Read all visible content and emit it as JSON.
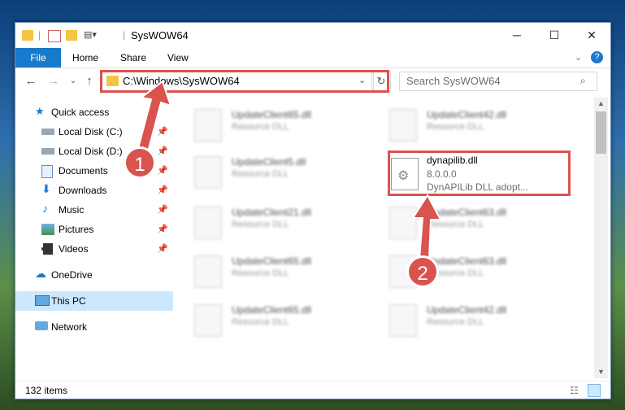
{
  "window": {
    "title": "SysWOW64",
    "controls": {
      "minimize": "─",
      "maximize": "☐",
      "close": "✕"
    }
  },
  "ribbon": {
    "file": "File",
    "tabs": [
      "Home",
      "Share",
      "View"
    ]
  },
  "address": {
    "path": "C:\\Windows\\SysWOW64",
    "search_placeholder": "Search SysWOW64"
  },
  "nav": {
    "quick_access": "Quick access",
    "items": [
      {
        "label": "Local Disk (C:)"
      },
      {
        "label": "Local Disk (D:)"
      },
      {
        "label": "Documents"
      },
      {
        "label": "Downloads"
      },
      {
        "label": "Music"
      },
      {
        "label": "Pictures"
      },
      {
        "label": "Videos"
      }
    ],
    "onedrive": "OneDrive",
    "this_pc": "This PC",
    "network": "Network"
  },
  "files": {
    "left": [
      {
        "name": "UpdateClient65.dll",
        "type": "Resource DLL"
      },
      {
        "name": "UpdateClient5.dll",
        "type": "Resource DLL"
      },
      {
        "name": "UpdateClient21.dll",
        "type": "Resource DLL"
      },
      {
        "name": "UpdateClient65.dll",
        "type": "Resource DLL"
      },
      {
        "name": "UpdateClient65.dll",
        "type": "Resource DLL"
      }
    ],
    "right": [
      {
        "name": "UpdateClient42.dll",
        "type": "Resource DLL"
      },
      {
        "name": "UpdateClient63.dll",
        "type": "Resource DLL"
      },
      {
        "name": "UpdateClient63.dll",
        "type": "Resource DLL"
      },
      {
        "name": "UpdateClient42.dll",
        "type": "Resource DLL"
      }
    ],
    "highlighted": {
      "name": "dynapilib.dll",
      "version": "8.0.0.0",
      "description": "DynAPILib DLL adopt..."
    }
  },
  "status": {
    "count": "132 items"
  },
  "annotations": {
    "one": "1",
    "two": "2"
  },
  "colors": {
    "accent": "#1979ca",
    "annotation": "#d9534f"
  }
}
